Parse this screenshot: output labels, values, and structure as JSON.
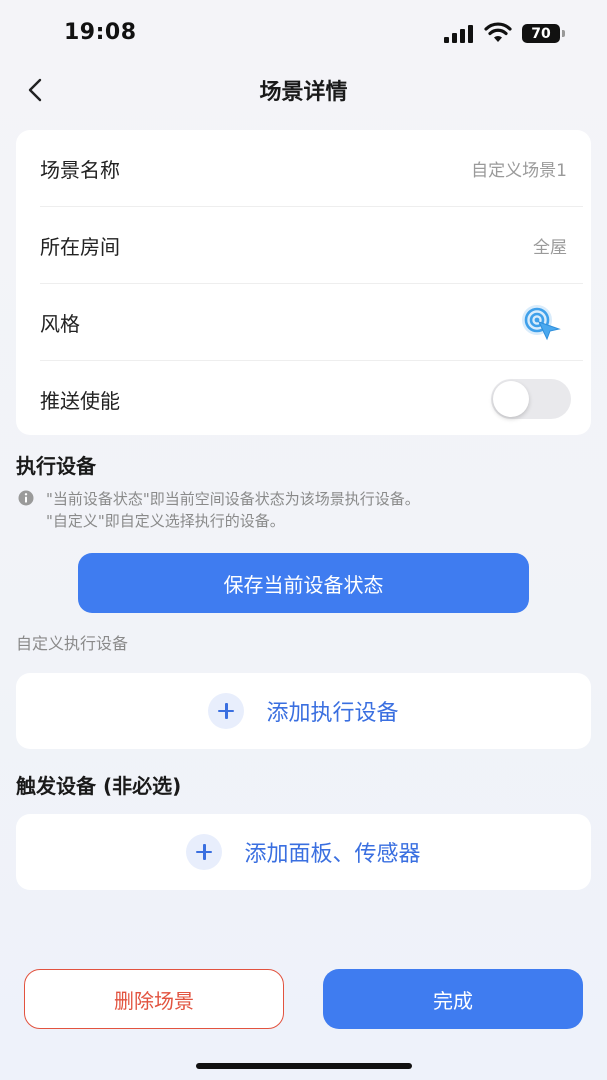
{
  "status_bar": {
    "time": "19:08",
    "battery": "70",
    "icons": [
      "signal-icon",
      "wifi-icon",
      "battery-icon"
    ]
  },
  "nav": {
    "title": "场景详情",
    "back_icon": "chevron-left-icon"
  },
  "info": {
    "scene_name_label": "场景名称",
    "scene_name_value": "自定义场景1",
    "room_label": "所在房间",
    "room_value": "全屋",
    "style_label": "风格",
    "style_icon": "target-pointer-icon",
    "push_label": "推送使能",
    "push_enabled": false
  },
  "execution": {
    "title": "执行设备",
    "hint_line1": "\"当前设备状态\"即当前空间设备状态为该场景执行设备。",
    "hint_line2": "\"自定义\"即自定义选择执行的设备。",
    "save_button": "保存当前设备状态",
    "custom_label": "自定义执行设备",
    "add_device": "添加执行设备"
  },
  "trigger": {
    "title": "触发设备 (非必选)",
    "add_sensor": "添加面板、传感器"
  },
  "footer": {
    "delete_button": "删除场景",
    "done_button": "完成"
  },
  "colors": {
    "primary": "#3f7cf0",
    "danger": "#e2533f",
    "text_secondary": "#9a9a9a"
  }
}
